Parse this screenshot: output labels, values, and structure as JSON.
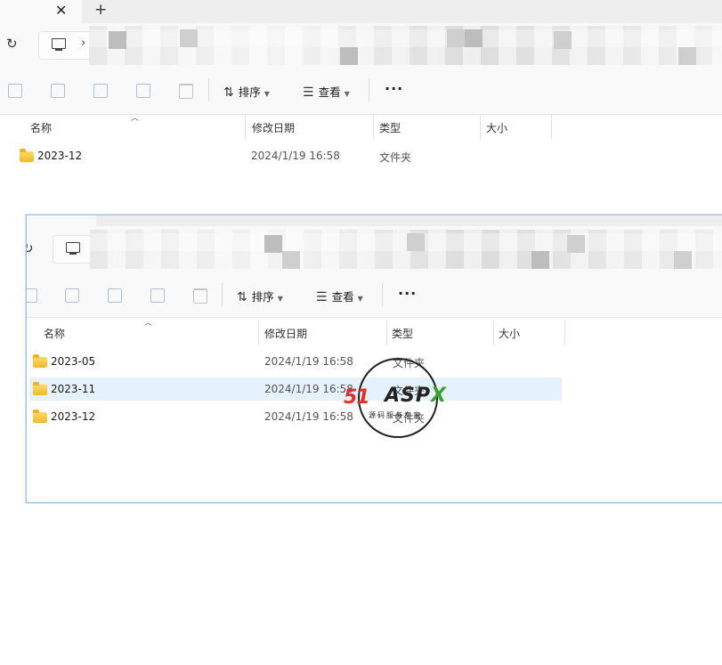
{
  "window_back": {
    "tab": {
      "close_glyph": "✕",
      "new_tab_glyph": "+"
    },
    "nav": {
      "refresh_glyph": "↻",
      "breadcrumb_sep": "›"
    },
    "toolbar": {
      "sort_label": "排序",
      "view_label": "查看",
      "more_label": "···"
    },
    "columns": {
      "name": "名称",
      "date": "修改日期",
      "type": "类型",
      "size": "大小"
    },
    "rows": [
      {
        "name": "2023-12",
        "date": "2024/1/19 16:58",
        "type": "文件夹",
        "size": ""
      }
    ]
  },
  "window_front": {
    "nav": {
      "refresh_glyph": "↻"
    },
    "toolbar": {
      "sort_label": "排序",
      "view_label": "查看",
      "more_label": "···"
    },
    "columns": {
      "name": "名称",
      "date": "修改日期",
      "type": "类型",
      "size": "大小"
    },
    "rows": [
      {
        "name": "2023-05",
        "date": "2024/1/19 16:58",
        "type": "文件夹",
        "size": "",
        "selected": false
      },
      {
        "name": "2023-11",
        "date": "2024/1/19 16:58",
        "type": "文件夹",
        "size": "",
        "selected": true
      },
      {
        "name": "2023-12",
        "date": "2024/1/19 16:58",
        "type": "文件夹",
        "size": "",
        "selected": false
      }
    ]
  },
  "watermark": {
    "brand_num": "51",
    "brand_text": "ASP",
    "brand_x": "X",
    "tagline": "源码服务专家"
  },
  "icons": [
    "copy-icon",
    "paste-icon",
    "rename-icon",
    "share-icon",
    "delete-icon",
    "sort-icon",
    "view-icon",
    "computer-icon",
    "folder-icon"
  ],
  "colors": {
    "selection": "#e5f1fb",
    "window_border": "#9ec3ea",
    "folder": "#f5b82a"
  }
}
